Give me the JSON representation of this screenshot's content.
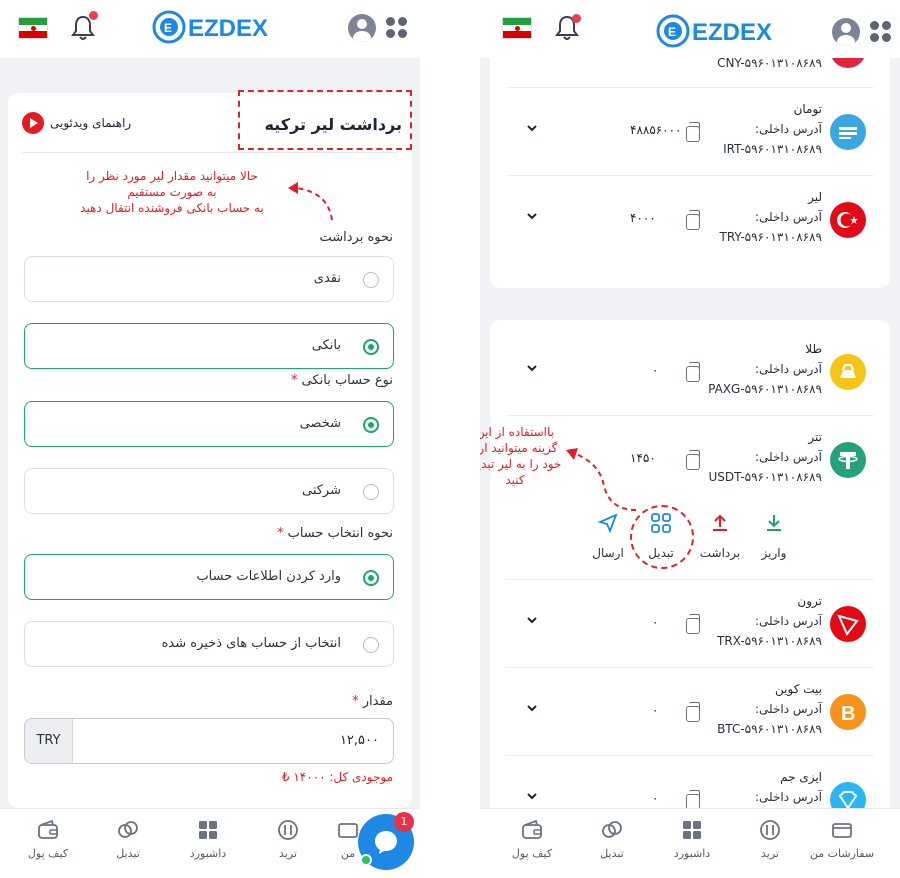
{
  "left": {
    "title": "برداشت لیر ترکیه",
    "video_guide": "راهنمای ویدئویی",
    "annotation": [
      "حالا میتوانید مقدار لیر مورد نظر را",
      "به صورت مستقیم",
      "به حساب بانکی فروشنده انتقال دهید"
    ],
    "withdraw_method_label": "نحوه برداشت",
    "options_method": [
      {
        "label": "نقدی",
        "selected": false
      },
      {
        "label": "بانکی",
        "selected": true
      }
    ],
    "account_type_label": "نوع حساب بانکی",
    "required_mark": "*",
    "options_account": [
      {
        "label": "شخصی",
        "selected": true
      },
      {
        "label": "شرکتی",
        "selected": false
      }
    ],
    "select_account_label": "نحوه انتخاب حساب",
    "options_select": [
      {
        "label": "وارد کردن اطلاعات حساب",
        "selected": true
      },
      {
        "label": "انتخاب از حساب های ذخیره شده",
        "selected": false
      }
    ],
    "amount_label": "مقدار",
    "amount_currency": "TRY",
    "amount_value": "۱۲,۵۰۰",
    "balance": "موجودی کل: ۱۴۰۰۰ ₺",
    "nav": [
      "کیف پول",
      "تبدیل",
      "داشبورد",
      "ترید",
      "من"
    ],
    "chat_badge": "1"
  },
  "right": {
    "partial_addr": "CNY-۵۹۶۰۱۳۱۰۸۶۸۹",
    "annotation": [
      "بااستفاده از این",
      "گزینه میتوانید ارز",
      "خود را به لیر تبدیل",
      "کنید"
    ],
    "rows_top": [
      {
        "name": "تومان",
        "addr_label": "آدرس داخلی:",
        "addr": "IRT-۵۹۶۰۱۳۱۰۸۶۸۹",
        "balance": "۴۸۸۵۶۰۰۰"
      },
      {
        "name": "لیر",
        "addr_label": "آدرس داخلی:",
        "addr": "TRY-۵۹۶۰۱۳۱۰۸۶۸۹",
        "balance": "۴۰۰۰"
      }
    ],
    "rows_bottom": [
      {
        "name": "طلا",
        "addr_label": "آدرس داخلی:",
        "addr": "PAXG-۵۹۶۰۱۳۱۰۸۶۸۹",
        "balance": "۰"
      },
      {
        "name": "تتر",
        "addr_label": "آدرس داخلی:",
        "addr": "USDT-۵۹۶۰۱۳۱۰۸۶۸۹",
        "balance": "۱۴۵۰"
      },
      {
        "name": "ترون",
        "addr_label": "آدرس داخلی:",
        "addr": "TRX-۵۹۶۰۱۳۱۰۸۶۸۹",
        "balance": "۰"
      },
      {
        "name": "بیت کوین",
        "addr_label": "آدرس داخلی:",
        "addr": "BTC-۵۹۶۰۱۳۱۰۸۶۸۹",
        "balance": "۰"
      },
      {
        "name": "ایزی جم",
        "addr_label": "آدرس داخلی:",
        "addr": "",
        "balance": "۰"
      }
    ],
    "actions": [
      "واریز",
      "برداشت",
      "تبدیل",
      "ارسال"
    ],
    "nav": [
      "سفارشات من",
      "ترید",
      "داشبورد",
      "تبدیل",
      "کیف پول"
    ]
  },
  "colors": {
    "accent_green": "#1aa86b",
    "annotation_red": "#e11d2a",
    "brand_blue": "#1e88e5"
  }
}
